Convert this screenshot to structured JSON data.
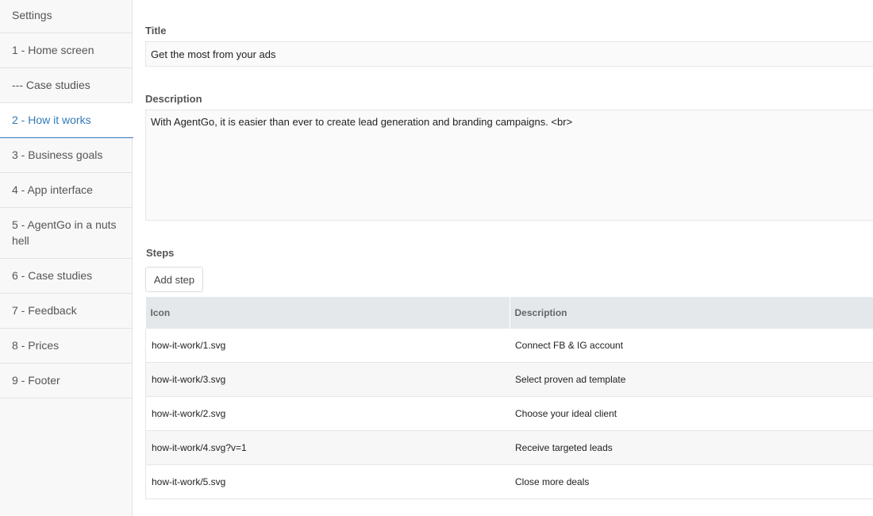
{
  "sidebar": {
    "items": [
      {
        "label": "Settings"
      },
      {
        "label": "1 - Home screen"
      },
      {
        "label": "--- Case studies"
      },
      {
        "label": "2 - How it works"
      },
      {
        "label": "3 - Business goals"
      },
      {
        "label": "4 - App interface"
      },
      {
        "label": "5 - AgentGo in a nuts hell"
      },
      {
        "label": "6 - Case studies"
      },
      {
        "label": "7 - Feedback"
      },
      {
        "label": "8 - Prices"
      },
      {
        "label": "9 - Footer"
      }
    ],
    "active_index": 3
  },
  "form": {
    "title_label": "Title",
    "title_value": "Get the most from your ads",
    "description_label": "Description",
    "description_value": "With AgentGo, it is easier than ever to create lead generation and branding campaigns. <br>",
    "steps_label": "Steps",
    "add_step_label": "Add step"
  },
  "steps_table": {
    "columns": [
      "Icon",
      "Description"
    ],
    "rows": [
      {
        "icon": "how-it-work/1.svg",
        "description": "Connect FB & IG account"
      },
      {
        "icon": "how-it-work/3.svg",
        "description": "Select proven ad template"
      },
      {
        "icon": "how-it-work/2.svg",
        "description": "Choose your ideal client"
      },
      {
        "icon": "how-it-work/4.svg?v=1",
        "description": "Receive targeted leads"
      },
      {
        "icon": "how-it-work/5.svg",
        "description": "Close more deals"
      }
    ]
  },
  "colors": {
    "accent": "#337ab7",
    "table_header_bg": "#e4e8eb",
    "sidebar_bg": "#f8f8f8"
  }
}
